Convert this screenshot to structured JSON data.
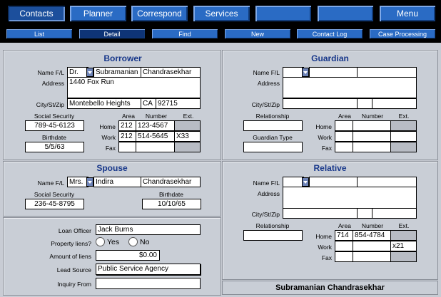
{
  "nav": {
    "primary": [
      {
        "label": "Contacts",
        "active": true
      },
      {
        "label": "Planner"
      },
      {
        "label": "Correspond"
      },
      {
        "label": "Services"
      },
      {
        "label": ""
      },
      {
        "label": ""
      },
      {
        "label": "Menu"
      }
    ],
    "secondary": [
      {
        "label": "List"
      },
      {
        "label": "Detail",
        "active": true
      },
      {
        "label": "Find"
      },
      {
        "label": "New"
      },
      {
        "label": "Contact Log"
      },
      {
        "label": "Case Processing"
      }
    ]
  },
  "labels": {
    "name": "Name F/L",
    "address": "Address",
    "city": "City/St/Zip",
    "ssn": "Social Security",
    "birthdate": "Birthdate",
    "area": "Area",
    "number": "Number",
    "ext": "Ext.",
    "home": "Home",
    "work": "Work",
    "fax": "Fax",
    "relationship": "Relationship",
    "guardian_type": "Guardian Type",
    "loan_officer": "Loan Officer",
    "property_liens": "Property liens?",
    "yes": "Yes",
    "no": "No",
    "amount_liens": "Amount of liens",
    "lead_source": "Lead Source",
    "inquiry_from": "Inquiry From"
  },
  "borrower": {
    "title": "Borrower",
    "prefix": "Dr.",
    "first": "Subramanian",
    "last": "Chandrasekhar",
    "address": "1440 Fox Run",
    "city": "Montebello Heights",
    "state": "CA",
    "zip": "92715",
    "ssn": "789-45-6123",
    "birthdate": "5/5/63",
    "home_area": "212",
    "home_number": "123-4567",
    "home_ext": "",
    "work_area": "212",
    "work_number": "514-5645",
    "work_ext": "X33",
    "fax_area": "",
    "fax_number": "",
    "fax_ext": ""
  },
  "guardian": {
    "title": "Guardian",
    "prefix": "",
    "first": "",
    "last": "",
    "address": "",
    "city": "",
    "state": "",
    "zip": "",
    "relationship": "",
    "guardian_type": ""
  },
  "spouse": {
    "title": "Spouse",
    "prefix": "Mrs.",
    "first": "Indira",
    "last": "Chandrasekhar",
    "ssn": "236-45-8795",
    "birthdate": "10/10/65"
  },
  "relative": {
    "title": "Relative",
    "relationship": "",
    "home_area": "714",
    "home_number": "854-4784",
    "home_ext": "",
    "work_area": "",
    "work_number": "",
    "work_ext": "x21"
  },
  "loan": {
    "officer": "Jack Burns",
    "amount_liens": "$0.00",
    "lead_source": "Public Service Agency",
    "inquiry_from": ""
  },
  "footer_name": "Subramanian Chandrasekhar"
}
